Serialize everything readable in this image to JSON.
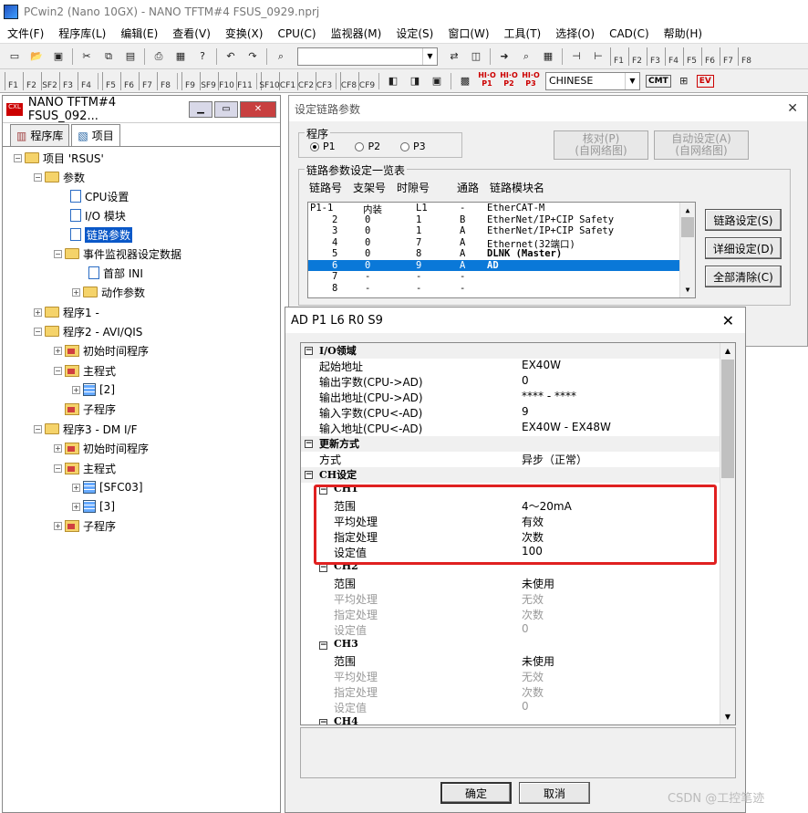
{
  "app": {
    "title": "PCwin2 (Nano 10GX)  - NANO TFTM#4 FSUS_0929.nprj"
  },
  "menu": [
    "文件(F)",
    "程序库(L)",
    "编辑(E)",
    "查看(V)",
    "变换(X)",
    "CPU(C)",
    "监视器(M)",
    "设定(S)",
    "窗口(W)",
    "工具(T)",
    "选择(O)",
    "CAD(C)",
    "帮助(H)"
  ],
  "toolbar": {
    "language": "CHINESE",
    "p1": "P1",
    "p2": "P2",
    "p3": "P3",
    "cmt": "CMT",
    "ev": "EV"
  },
  "project": {
    "title": "NANO TFTM#4 FSUS_092...",
    "tab_library": "程序库",
    "tab_project": "项目",
    "tree": {
      "root": "项目 'RSUS'",
      "params": "参数",
      "cpu": "CPU设置",
      "io": "I/O 模块",
      "link": "链路参数",
      "event": "事件监视器设定数据",
      "header": "首部 INI",
      "action": "动作参数",
      "prog1": "程序1 -",
      "prog2": "程序2 - AVI/QIS",
      "init1": "初始时间程序",
      "main1": "主程式",
      "item2": "[2]",
      "sub1": "子程序",
      "prog3": "程序3 - DM I/F",
      "init2": "初始时间程序",
      "main2": "主程式",
      "sfc03": "[SFC03]",
      "item3": "[3]",
      "sub2": "子程序"
    }
  },
  "link_dialog": {
    "title": "设定链路参数",
    "program_group": "程序",
    "p1": "P1",
    "p2": "P2",
    "p3": "P3",
    "btn_check": "核对(P)\n(自网络图)",
    "btn_auto": "自动设定(A)\n(自网络图)",
    "list_group": "链路参数设定一览表",
    "headers": [
      "链路号",
      "支架号",
      "时隙号",
      "通路",
      "链路模块名"
    ],
    "rows": [
      [
        "P1-1",
        "内装",
        "L1",
        "-",
        "EtherCAT-M"
      ],
      [
        "2",
        "0",
        "1",
        "B",
        "EtherNet/IP+CIP Safety"
      ],
      [
        "3",
        "0",
        "1",
        "A",
        "EtherNet/IP+CIP Safety"
      ],
      [
        "4",
        "0",
        "7",
        "A",
        "Ethernet(32端口)"
      ],
      [
        "5",
        "0",
        "8",
        "A",
        "DLNK (Master)"
      ],
      [
        "6",
        "0",
        "9",
        "A",
        "AD"
      ],
      [
        "7",
        "-",
        "-",
        "-",
        ""
      ],
      [
        "8",
        "-",
        "-",
        "-",
        ""
      ]
    ],
    "btn_link": "链路设定(S)",
    "btn_detail": "详细设定(D)",
    "btn_clear": "全部清除(C)"
  },
  "ad_dialog": {
    "title": "AD  P1 L6 R0 S9",
    "props": [
      {
        "k": "I/O领域",
        "v": "",
        "type": "cat"
      },
      {
        "k": "起始地址",
        "v": "EX40W"
      },
      {
        "k": "输出字数(CPU->AD)",
        "v": "0"
      },
      {
        "k": "输出地址(CPU->AD)",
        "v": "**** - ****"
      },
      {
        "k": "输入字数(CPU<-AD)",
        "v": "9"
      },
      {
        "k": "输入地址(CPU<-AD)",
        "v": "EX40W - EX48W"
      },
      {
        "k": "更新方式",
        "v": "",
        "type": "cat"
      },
      {
        "k": "方式",
        "v": "异步（正常）"
      },
      {
        "k": "CH设定",
        "v": "",
        "type": "cat"
      },
      {
        "k": "CH1",
        "v": "",
        "type": "subcat"
      },
      {
        "k": "范围",
        "v": "4～20mA",
        "type": "sub"
      },
      {
        "k": "平均处理",
        "v": "有效",
        "type": "sub"
      },
      {
        "k": "指定处理",
        "v": "次数",
        "type": "sub"
      },
      {
        "k": "设定值",
        "v": "100",
        "type": "sub"
      },
      {
        "k": "CH2",
        "v": "",
        "type": "subcat"
      },
      {
        "k": "范围",
        "v": "未使用",
        "type": "sub"
      },
      {
        "k": "平均处理",
        "v": "无效",
        "type": "subdis"
      },
      {
        "k": "指定处理",
        "v": "次数",
        "type": "subdis"
      },
      {
        "k": "设定值",
        "v": "0",
        "type": "subdis"
      },
      {
        "k": "CH3",
        "v": "",
        "type": "subcat"
      },
      {
        "k": "范围",
        "v": "未使用",
        "type": "sub"
      },
      {
        "k": "平均处理",
        "v": "无效",
        "type": "subdis"
      },
      {
        "k": "指定处理",
        "v": "次数",
        "type": "subdis"
      },
      {
        "k": "设定值",
        "v": "0",
        "type": "subdis"
      },
      {
        "k": "CH4",
        "v": "",
        "type": "subcat"
      }
    ],
    "ok": "确定",
    "cancel": "取消"
  },
  "watermark": "CSDN @工控笔迹"
}
